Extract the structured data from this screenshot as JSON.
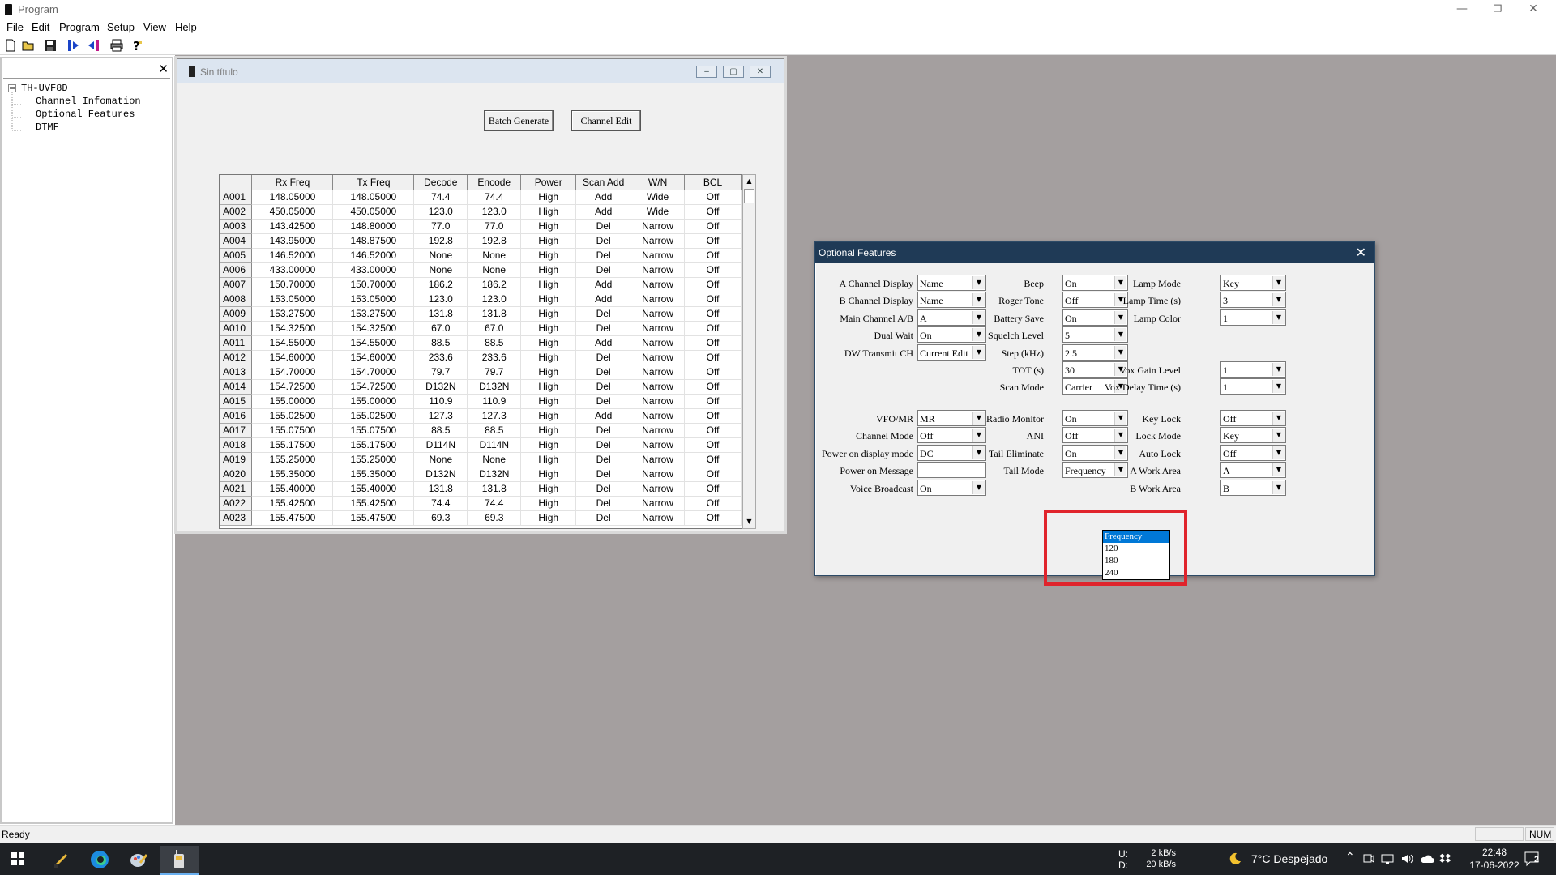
{
  "window": {
    "title": "Program",
    "minimize": "—",
    "restore": "❐",
    "close": "✕"
  },
  "menu": [
    "File",
    "Edit",
    "Program",
    "Setup",
    "View",
    "Help"
  ],
  "toolbar": {
    "icons": [
      "new-file-icon",
      "open-folder-icon",
      "save-icon",
      "read-from-radio-icon",
      "write-to-radio-icon",
      "print-icon",
      "help-icon"
    ]
  },
  "tree": {
    "close": "✕",
    "root": "TH-UVF8D",
    "items": [
      "Channel Infomation",
      "Optional Features",
      "DTMF"
    ]
  },
  "child_window": {
    "title": "Sin título",
    "min": "–",
    "max": "▢",
    "close": "✕",
    "batch_generate": "Batch Generate",
    "channel_edit": "Channel Edit",
    "columns": [
      "Rx Freq",
      "Tx Freq",
      "Decode",
      "Encode",
      "Power",
      "Scan Add",
      "W/N",
      "BCL"
    ],
    "rows": [
      [
        "A001",
        "148.05000",
        "148.05000",
        "74.4",
        "74.4",
        "High",
        "Add",
        "Wide",
        "Off"
      ],
      [
        "A002",
        "450.05000",
        "450.05000",
        "123.0",
        "123.0",
        "High",
        "Add",
        "Wide",
        "Off"
      ],
      [
        "A003",
        "143.42500",
        "148.80000",
        "77.0",
        "77.0",
        "High",
        "Del",
        "Narrow",
        "Off"
      ],
      [
        "A004",
        "143.95000",
        "148.87500",
        "192.8",
        "192.8",
        "High",
        "Del",
        "Narrow",
        "Off"
      ],
      [
        "A005",
        "146.52000",
        "146.52000",
        "None",
        "None",
        "High",
        "Del",
        "Narrow",
        "Off"
      ],
      [
        "A006",
        "433.00000",
        "433.00000",
        "None",
        "None",
        "High",
        "Del",
        "Narrow",
        "Off"
      ],
      [
        "A007",
        "150.70000",
        "150.70000",
        "186.2",
        "186.2",
        "High",
        "Add",
        "Narrow",
        "Off"
      ],
      [
        "A008",
        "153.05000",
        "153.05000",
        "123.0",
        "123.0",
        "High",
        "Add",
        "Narrow",
        "Off"
      ],
      [
        "A009",
        "153.27500",
        "153.27500",
        "131.8",
        "131.8",
        "High",
        "Del",
        "Narrow",
        "Off"
      ],
      [
        "A010",
        "154.32500",
        "154.32500",
        "67.0",
        "67.0",
        "High",
        "Del",
        "Narrow",
        "Off"
      ],
      [
        "A011",
        "154.55000",
        "154.55000",
        "88.5",
        "88.5",
        "High",
        "Add",
        "Narrow",
        "Off"
      ],
      [
        "A012",
        "154.60000",
        "154.60000",
        "233.6",
        "233.6",
        "High",
        "Del",
        "Narrow",
        "Off"
      ],
      [
        "A013",
        "154.70000",
        "154.70000",
        "79.7",
        "79.7",
        "High",
        "Del",
        "Narrow",
        "Off"
      ],
      [
        "A014",
        "154.72500",
        "154.72500",
        "D132N",
        "D132N",
        "High",
        "Del",
        "Narrow",
        "Off"
      ],
      [
        "A015",
        "155.00000",
        "155.00000",
        "110.9",
        "110.9",
        "High",
        "Del",
        "Narrow",
        "Off"
      ],
      [
        "A016",
        "155.02500",
        "155.02500",
        "127.3",
        "127.3",
        "High",
        "Add",
        "Narrow",
        "Off"
      ],
      [
        "A017",
        "155.07500",
        "155.07500",
        "88.5",
        "88.5",
        "High",
        "Del",
        "Narrow",
        "Off"
      ],
      [
        "A018",
        "155.17500",
        "155.17500",
        "D114N",
        "D114N",
        "High",
        "Del",
        "Narrow",
        "Off"
      ],
      [
        "A019",
        "155.25000",
        "155.25000",
        "None",
        "None",
        "High",
        "Del",
        "Narrow",
        "Off"
      ],
      [
        "A020",
        "155.35000",
        "155.35000",
        "D132N",
        "D132N",
        "High",
        "Del",
        "Narrow",
        "Off"
      ],
      [
        "A021",
        "155.40000",
        "155.40000",
        "131.8",
        "131.8",
        "High",
        "Del",
        "Narrow",
        "Off"
      ],
      [
        "A022",
        "155.42500",
        "155.42500",
        "74.4",
        "74.4",
        "High",
        "Del",
        "Narrow",
        "Off"
      ],
      [
        "A023",
        "155.47500",
        "155.47500",
        "69.3",
        "69.3",
        "High",
        "Del",
        "Narrow",
        "Off"
      ]
    ],
    "scroll_up": "▲",
    "scroll_down": "▼"
  },
  "dialog": {
    "title": "Optional Features",
    "close": "✕",
    "arrow": "▼",
    "fields": {
      "a_channel_display": {
        "label": "A Channel Display",
        "value": "Name"
      },
      "b_channel_display": {
        "label": "B Channel Display",
        "value": "Name"
      },
      "main_channel_ab": {
        "label": "Main Channel A/B",
        "value": "A"
      },
      "dual_wait": {
        "label": "Dual Wait",
        "value": "On"
      },
      "dw_transmit_ch": {
        "label": "DW Transmit CH",
        "value": "Current Edit"
      },
      "beep": {
        "label": "Beep",
        "value": "On"
      },
      "roger_tone": {
        "label": "Roger Tone",
        "value": "Off"
      },
      "battery_save": {
        "label": "Battery Save",
        "value": "On"
      },
      "squelch_level": {
        "label": "Squelch Level",
        "value": "5"
      },
      "step": {
        "label": "Step (kHz)",
        "value": "2.5"
      },
      "tot": {
        "label": "TOT (s)",
        "value": "30"
      },
      "scan_mode": {
        "label": "Scan Mode",
        "value": "Carrier"
      },
      "lamp_mode": {
        "label": "Lamp Mode",
        "value": "Key"
      },
      "lamp_time": {
        "label": "Lamp Time (s)",
        "value": "3"
      },
      "lamp_color": {
        "label": "Lamp Color",
        "value": "1"
      },
      "vox_gain_level": {
        "label": "Vox Gain Level",
        "value": "1"
      },
      "vox_delay_time": {
        "label": "Vox Delay Time (s)",
        "value": "1"
      },
      "vfo_mr": {
        "label": "VFO/MR",
        "value": "MR"
      },
      "channel_mode": {
        "label": "Channel Mode",
        "value": "Off"
      },
      "power_on_display_mode": {
        "label": "Power on display mode",
        "value": "DC"
      },
      "power_on_message": {
        "label": "Power on Message",
        "value": ""
      },
      "voice_broadcast": {
        "label": "Voice Broadcast",
        "value": "On"
      },
      "radio_monitor": {
        "label": "Radio Monitor",
        "value": "On"
      },
      "ani": {
        "label": "ANI",
        "value": "Off"
      },
      "tail_eliminate": {
        "label": "Tail Eliminate",
        "value": "On"
      },
      "tail_mode": {
        "label": "Tail Mode",
        "value": "Frequency",
        "options": [
          "Frequency",
          "120",
          "180",
          "240"
        ]
      },
      "key_lock": {
        "label": "Key Lock",
        "value": "Off"
      },
      "lock_mode": {
        "label": "Lock Mode",
        "value": "Key"
      },
      "auto_lock": {
        "label": "Auto Lock",
        "value": "Off"
      },
      "a_work_area": {
        "label": "A Work Area",
        "value": "A"
      },
      "b_work_area": {
        "label": "B Work Area",
        "value": "B"
      }
    }
  },
  "statusbar": {
    "text": "Ready",
    "num": "NUM"
  },
  "taskbar": {
    "apps": [
      "pinned-app-icon",
      "edge-icon",
      "paint-icon",
      "radio-program-icon"
    ],
    "net_up_label": "U:",
    "net_down_label": "D:",
    "net_up": "2 kB/s",
    "net_down": "20 kB/s",
    "weather": "7°C  Despejado",
    "time": "22:48",
    "date": "17-06-2022",
    "notifications": "2",
    "colors": {
      "taskbar": "#1e2125",
      "accent": "#0078d7",
      "highlight": "#e0242c"
    }
  }
}
